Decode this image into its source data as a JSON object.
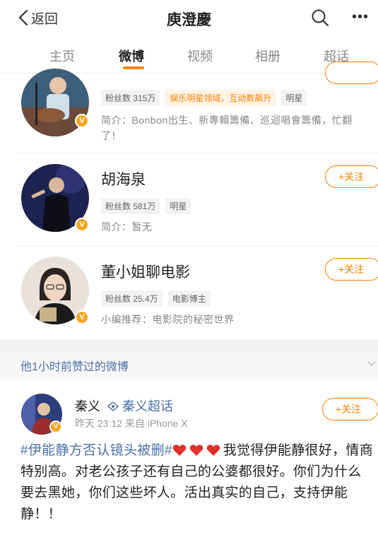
{
  "header": {
    "back_label": "返回",
    "title": "庾澄慶"
  },
  "tabs": [
    "主页",
    "微博",
    "视频",
    "相册",
    "超话"
  ],
  "users": [
    {
      "name": "",
      "tags": [
        "粉丝数 315万",
        "娱乐明星领域，互动数飙升",
        "明星"
      ],
      "desc": "简介：Bonbon出生、新專輯籌備、巡迴唱會籌備，忙翻了！"
    },
    {
      "name": "胡海泉",
      "tags": [
        "粉丝数 581万",
        "明星"
      ],
      "desc": "简介：暂无",
      "follow": "+关注"
    },
    {
      "name": "董小姐聊电影",
      "tags": [
        "粉丝数 25.4万",
        "电影博主"
      ],
      "desc": "小编推荐：电影院的秘密世界",
      "follow": "+关注"
    }
  ],
  "section": {
    "title": "他1小时前赞过的微博"
  },
  "post": {
    "author": "秦义",
    "topic": "秦义超话",
    "time_source": "昨天 23:12  来自 iPhone X",
    "follow": "+关注",
    "hashtag": "#伊能静方否认镜头被删#",
    "text_after_hearts": "我觉得伊能静很好，情商特别高。对老公孩子还有自己的公婆都很好。你们为什么要去黑她，你们这些坏人。活出真实的自己，支持伊能静！！"
  },
  "colors": {
    "accent": "#ff8200",
    "link": "#4b72a8",
    "verified": "#f5a623",
    "heart": "#e0302b"
  },
  "icons": [
    "back-chevron-icon",
    "search-icon",
    "more-icon",
    "verified-icon",
    "super-topic-icon",
    "heart-icon",
    "chevron-down-icon"
  ]
}
